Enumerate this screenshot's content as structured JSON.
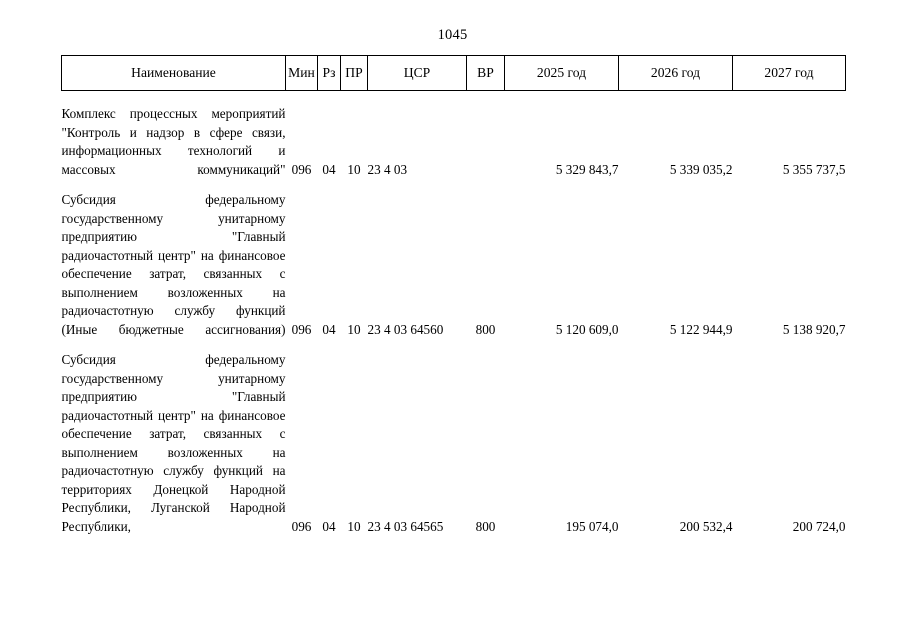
{
  "document": {
    "page_number": "1045"
  },
  "table": {
    "headers": [
      {
        "key": "name",
        "label": "Наименование"
      },
      {
        "key": "min",
        "label": "Мин"
      },
      {
        "key": "rz",
        "label": "Рз"
      },
      {
        "key": "pr",
        "label": "ПР"
      },
      {
        "key": "csr",
        "label": "ЦСР"
      },
      {
        "key": "vr",
        "label": "ВР"
      },
      {
        "key": "y2025",
        "label": "2025 год"
      },
      {
        "key": "y2026",
        "label": "2026 год"
      },
      {
        "key": "y2027",
        "label": "2027 год"
      }
    ],
    "rows": [
      {
        "name": "Комплекс процессных мероприятий \"Контроль и надзор в сфере связи, информационных технологий и массовых коммуникаций\"",
        "min": "096",
        "rz": "04",
        "pr": "10",
        "csr": "23 4 03",
        "vr": "",
        "y2025": "5 329 843,7",
        "y2026": "5 339 035,2",
        "y2027": "5 355 737,5"
      },
      {
        "name": "Субсидия федеральному государственному унитарному предприятию \"Главный радиочастотный центр\" на финансовое обеспечение затрат, связанных с выполнением возложенных на радиочастотную службу функций (Иные бюджетные ассигнования)",
        "min": "096",
        "rz": "04",
        "pr": "10",
        "csr": "23 4 03 64560",
        "vr": "800",
        "y2025": "5 120 609,0",
        "y2026": "5 122 944,9",
        "y2027": "5 138 920,7"
      },
      {
        "name": "Субсидия федеральному государственному унитарному предприятию \"Главный радиочастотный центр\" на финансовое обеспечение затрат, связанных с выполнением возложенных на радиочастотную службу функций на территориях Донецкой Народной Республики, Луганской Народной Республики,",
        "min": "096",
        "rz": "04",
        "pr": "10",
        "csr": "23 4 03 64565",
        "vr": "800",
        "y2025": "195 074,0",
        "y2026": "200 532,4",
        "y2027": "200 724,0"
      }
    ]
  }
}
